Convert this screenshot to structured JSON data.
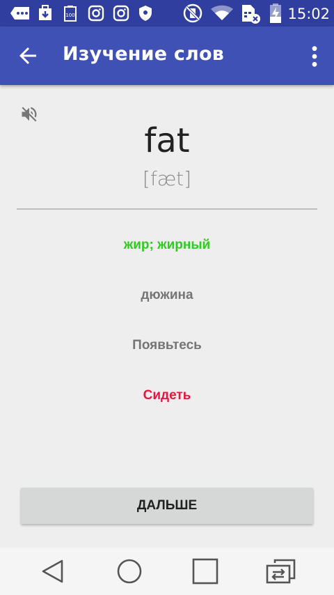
{
  "status_bar": {
    "time": "15:02",
    "icons": [
      "more-icon",
      "download-icon",
      "battery-100-icon",
      "instagram-icon",
      "instagram-icon",
      "shield-icon",
      "vibrate-off-icon",
      "wifi-icon",
      "sim-off-icon",
      "battery-charging-icon"
    ]
  },
  "app_bar": {
    "title": "Изучение слов",
    "back_icon": "arrow-back-icon",
    "menu_icon": "more-vert-icon",
    "color": "#3f51b5"
  },
  "card": {
    "sound_icon": "volume-off-icon",
    "word": "fat",
    "transcription": "[fæt]"
  },
  "options": [
    {
      "label": "жир; жирный",
      "state": "correct",
      "color": "#2ecc1f"
    },
    {
      "label": "дюжина",
      "state": "neutral",
      "color": "#757575"
    },
    {
      "label": "Появьтесь",
      "state": "neutral",
      "color": "#757575"
    },
    {
      "label": "Сидеть",
      "state": "wrong",
      "color": "#e8153f"
    }
  ],
  "next_button": {
    "label": "ДАЛЬШЕ"
  },
  "nav_bar": {
    "icons": [
      "back-triangle-icon",
      "home-circle-icon",
      "recents-square-icon",
      "switch-app-icon"
    ]
  }
}
